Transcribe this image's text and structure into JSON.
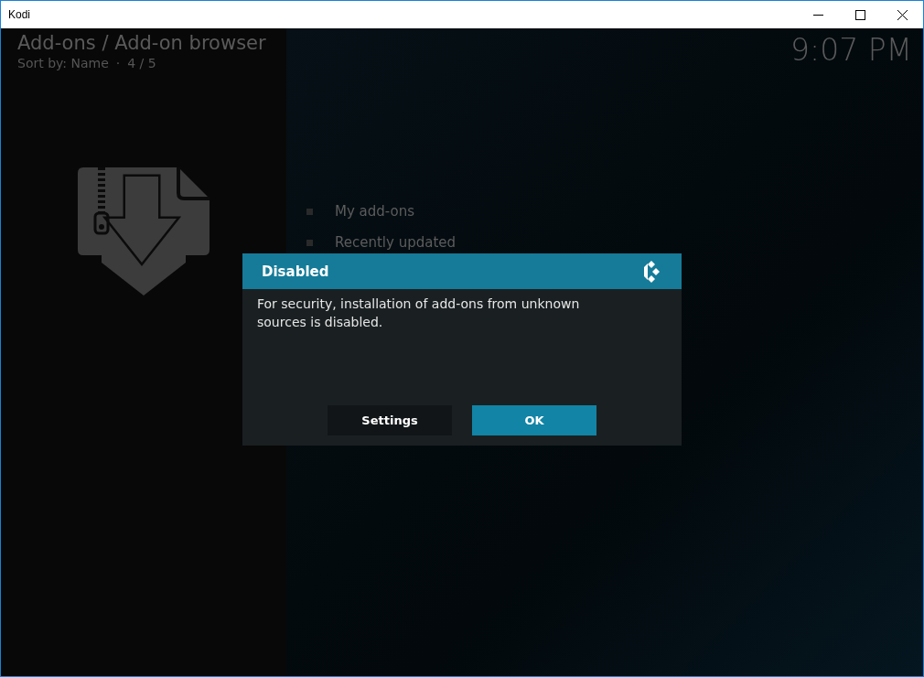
{
  "window": {
    "title": "Kodi"
  },
  "header": {
    "title": "Add-ons / Add-on browser",
    "sort": "Sort by: Name",
    "separator": "·",
    "position": "4 / 5",
    "clock": "9:07 PM"
  },
  "menu": [
    {
      "label": "My add-ons"
    },
    {
      "label": "Recently updated"
    }
  ],
  "dialog": {
    "title": "Disabled",
    "message": "For security, installation of add-ons from unknown sources is disabled.",
    "buttons": [
      {
        "label": "Settings",
        "selected": false
      },
      {
        "label": "OK",
        "selected": true
      }
    ]
  }
}
